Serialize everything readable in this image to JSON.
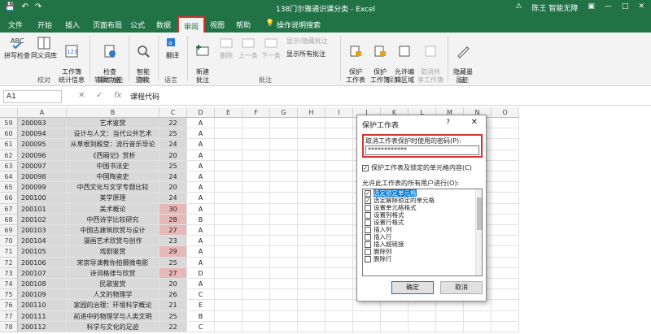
{
  "window": {
    "title": "138门尔雅通识课分类 - Excel",
    "user": "陈王 智能无障",
    "restore_label": "□",
    "close_label": "✕"
  },
  "tabs": [
    "文件",
    "开始",
    "插入",
    "页面布局",
    "公式",
    "数据",
    "审阅",
    "视图",
    "帮助",
    "操作说明搜索"
  ],
  "active_tab": "审阅",
  "ribbon": {
    "spelling": "拼写检查",
    "thesaurus": "同义词库",
    "stats": "工作簿\n统计信息",
    "check_access": "检查\n辅助功能",
    "smart_lookup": "智能\n查找",
    "translate": "翻译",
    "new_comment": "新建\n批注",
    "delete": "删除",
    "prev": "上一条",
    "next": "下一条",
    "show_hide": "显示/隐藏批注",
    "show_all": "显示所有批注",
    "protect_sheet": "保护\n工作表",
    "protect_wb": "保护\n工作簿",
    "allow_edit": "允许编\n辑区域",
    "unshare": "取消共\n享工作簿",
    "hide_ink": "隐藏墨\n迹",
    "groups": [
      "校对",
      "辅助功能",
      "见解",
      "语言",
      "批注",
      "保护",
      "墨迹"
    ]
  },
  "formula": {
    "namebox": "A1",
    "cancel": "✕",
    "enter": "✓",
    "fx": "fx",
    "content": "课程代码"
  },
  "columns": [
    "A",
    "B",
    "C",
    "D",
    "E",
    "F",
    "G",
    "H",
    "I",
    "J",
    "K",
    "L",
    "M",
    "N",
    "O"
  ],
  "rows": [
    {
      "n": "59",
      "a": "200093",
      "b": "艺术鉴赏",
      "c": "22",
      "d": "A"
    },
    {
      "n": "60",
      "a": "200094",
      "b": "设计与人文：当代公共艺术",
      "c": "25",
      "d": "A"
    },
    {
      "n": "61",
      "a": "200095",
      "b": "从草根到殿堂：流行音乐导论",
      "c": "24",
      "d": "A"
    },
    {
      "n": "62",
      "a": "200096",
      "b": "《西厢记》赏析",
      "c": "20",
      "d": "A"
    },
    {
      "n": "63",
      "a": "200097",
      "b": "中国书法史",
      "c": "25",
      "d": "A"
    },
    {
      "n": "64",
      "a": "200098",
      "b": "中国陶瓷史",
      "c": "24",
      "d": "A"
    },
    {
      "n": "65",
      "a": "200099",
      "b": "中西文化与文学专题比较",
      "c": "20",
      "d": "A"
    },
    {
      "n": "66",
      "a": "200100",
      "b": "美学原理",
      "c": "24",
      "d": "A"
    },
    {
      "n": "67",
      "a": "200101",
      "b": "美术概论",
      "c": "30",
      "d": "A"
    },
    {
      "n": "68",
      "a": "200102",
      "b": "中西诗学比较研究",
      "c": "28",
      "d": "B"
    },
    {
      "n": "69",
      "a": "200103",
      "b": "中国古建筑欣赏与设计",
      "c": "27",
      "d": "A"
    },
    {
      "n": "70",
      "a": "200104",
      "b": "漫画艺术欣赏与创作",
      "c": "23",
      "d": "A"
    },
    {
      "n": "71",
      "a": "200105",
      "b": "戏剧鉴赏",
      "c": "29",
      "d": "A"
    },
    {
      "n": "72",
      "a": "200106",
      "b": "宋崇导演教你拍摄微电影",
      "c": "25",
      "d": "A"
    },
    {
      "n": "73",
      "a": "200107",
      "b": "诗词格律与欣赏",
      "c": "27",
      "d": "D"
    },
    {
      "n": "74",
      "a": "200108",
      "b": "民歌鉴赏",
      "c": "20",
      "d": "A"
    },
    {
      "n": "75",
      "a": "200109",
      "b": "人文的物理学",
      "c": "26",
      "d": "C"
    },
    {
      "n": "76",
      "a": "200110",
      "b": "家园的治理：环境科学概论",
      "c": "21",
      "d": "E"
    },
    {
      "n": "77",
      "a": "200111",
      "b": "前进中的物理学与人类文明",
      "c": "25",
      "d": "B"
    },
    {
      "n": "78",
      "a": "200112",
      "b": "科学与文化的足迹",
      "c": "22",
      "d": "C"
    }
  ],
  "pink_rows": [
    8,
    9,
    10,
    12,
    14
  ],
  "dialog": {
    "title": "保护工作表",
    "help": "?",
    "close": "✕",
    "password_label": "取消工作表保护时使用的密码(P):",
    "password_value": "************",
    "protect_option": "保护工作表及锁定的单元格内容(C)",
    "allow_label": "允许此工作表的所有用户进行(O):",
    "permissions": [
      {
        "label": "选定锁定单元格",
        "checked": true
      },
      {
        "label": "选定解除锁定的单元格",
        "checked": true
      },
      {
        "label": "设置单元格格式",
        "checked": false
      },
      {
        "label": "设置列格式",
        "checked": false
      },
      {
        "label": "设置行格式",
        "checked": false
      },
      {
        "label": "插入列",
        "checked": false
      },
      {
        "label": "插入行",
        "checked": false
      },
      {
        "label": "插入超链接",
        "checked": false
      },
      {
        "label": "删除列",
        "checked": false
      },
      {
        "label": "删除行",
        "checked": false
      }
    ],
    "ok": "确定",
    "cancel": "取消"
  },
  "colors": {
    "excel_green": "#217346",
    "highlight_red": "#d9322c",
    "pink": "#e6b8b7"
  }
}
